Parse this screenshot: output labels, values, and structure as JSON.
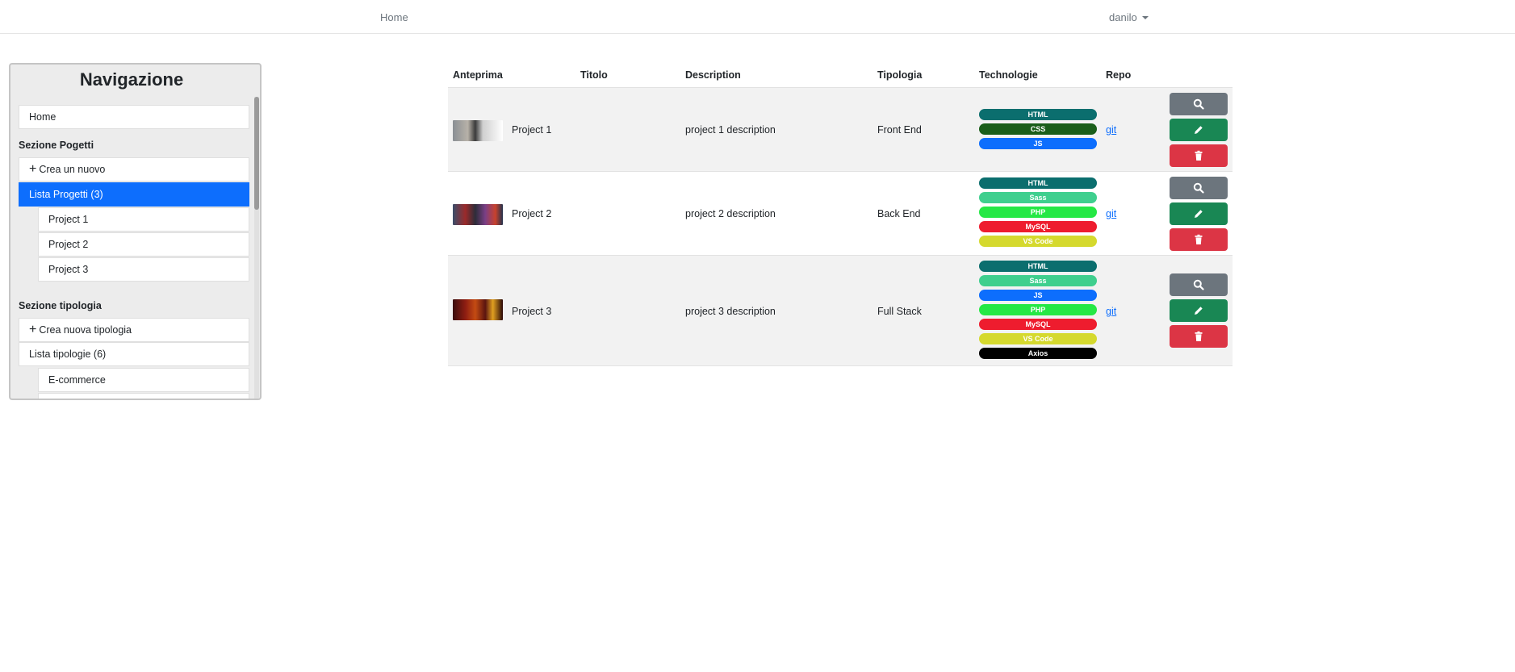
{
  "navbar": {
    "home": "Home",
    "user": "danilo"
  },
  "sidebar": {
    "title": "Navigazione",
    "home": "Home",
    "section_projects": "Sezione Pogetti",
    "create_project": "Crea un nuovo",
    "list_projects": "Lista Progetti (3)",
    "projects": [
      "Project 1",
      "Project 2",
      "Project 3"
    ],
    "section_types": "Sezione tipologia",
    "create_type": "Crea nuova tipologia",
    "list_types": "Lista tipologie (6)",
    "types": [
      "E-commerce"
    ]
  },
  "table": {
    "headers": [
      "Anteprima",
      "Titolo",
      "Description",
      "Tipologia",
      "Technologie",
      "Repo"
    ],
    "rows": [
      {
        "title": "Project 1",
        "description": "project 1 description",
        "type": "Front End",
        "repo": "git",
        "technologies": [
          {
            "name": "HTML",
            "color": "#0b6e6e"
          },
          {
            "name": "CSS",
            "color": "#1a5e1a"
          },
          {
            "name": "JS",
            "color": "#0d6efd"
          }
        ]
      },
      {
        "title": "Project 2",
        "description": "project 2 description",
        "type": "Back End",
        "repo": "git",
        "technologies": [
          {
            "name": "HTML",
            "color": "#0b6e6e"
          },
          {
            "name": "Sass",
            "color": "#3fcf8e"
          },
          {
            "name": "PHP",
            "color": "#25e845"
          },
          {
            "name": "MySQL",
            "color": "#ee1c2e"
          },
          {
            "name": "VS Code",
            "color": "#d5d92e"
          }
        ]
      },
      {
        "title": "Project 3",
        "description": "project 3 description",
        "type": "Full Stack",
        "repo": "git",
        "technologies": [
          {
            "name": "HTML",
            "color": "#0b6e6e"
          },
          {
            "name": "Sass",
            "color": "#3fcf8e"
          },
          {
            "name": "JS",
            "color": "#0d6efd"
          },
          {
            "name": "PHP",
            "color": "#25e845"
          },
          {
            "name": "MySQL",
            "color": "#ee1c2e"
          },
          {
            "name": "VS Code",
            "color": "#d5d92e"
          },
          {
            "name": "Axios",
            "color": "#000000"
          }
        ]
      }
    ]
  },
  "icons": {
    "show": "search-icon",
    "edit": "pencil-icon",
    "delete": "trash-icon"
  }
}
